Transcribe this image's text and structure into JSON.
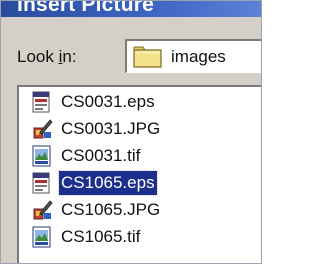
{
  "dialog": {
    "title": "Insert Picture"
  },
  "look_in": {
    "label_prefix": "Look ",
    "label_mnemonic": "i",
    "label_suffix": "n:",
    "value": "images",
    "icon": "folder-icon"
  },
  "files": [
    {
      "name": "CS0031.eps",
      "icon": "eps-file-icon",
      "selected": false
    },
    {
      "name": "CS0031.JPG",
      "icon": "jpg-file-icon",
      "selected": false
    },
    {
      "name": "CS0031.tif",
      "icon": "tif-file-icon",
      "selected": false
    },
    {
      "name": "CS1065.eps",
      "icon": "eps-file-icon",
      "selected": true
    },
    {
      "name": "CS1065.JPG",
      "icon": "jpg-file-icon",
      "selected": false
    },
    {
      "name": "CS1065.tif",
      "icon": "tif-file-icon",
      "selected": false
    }
  ],
  "colors": {
    "selection": "#1c2f8c",
    "titlebar": "#2a4c9e",
    "dialog_face": "#d4d0c8"
  }
}
